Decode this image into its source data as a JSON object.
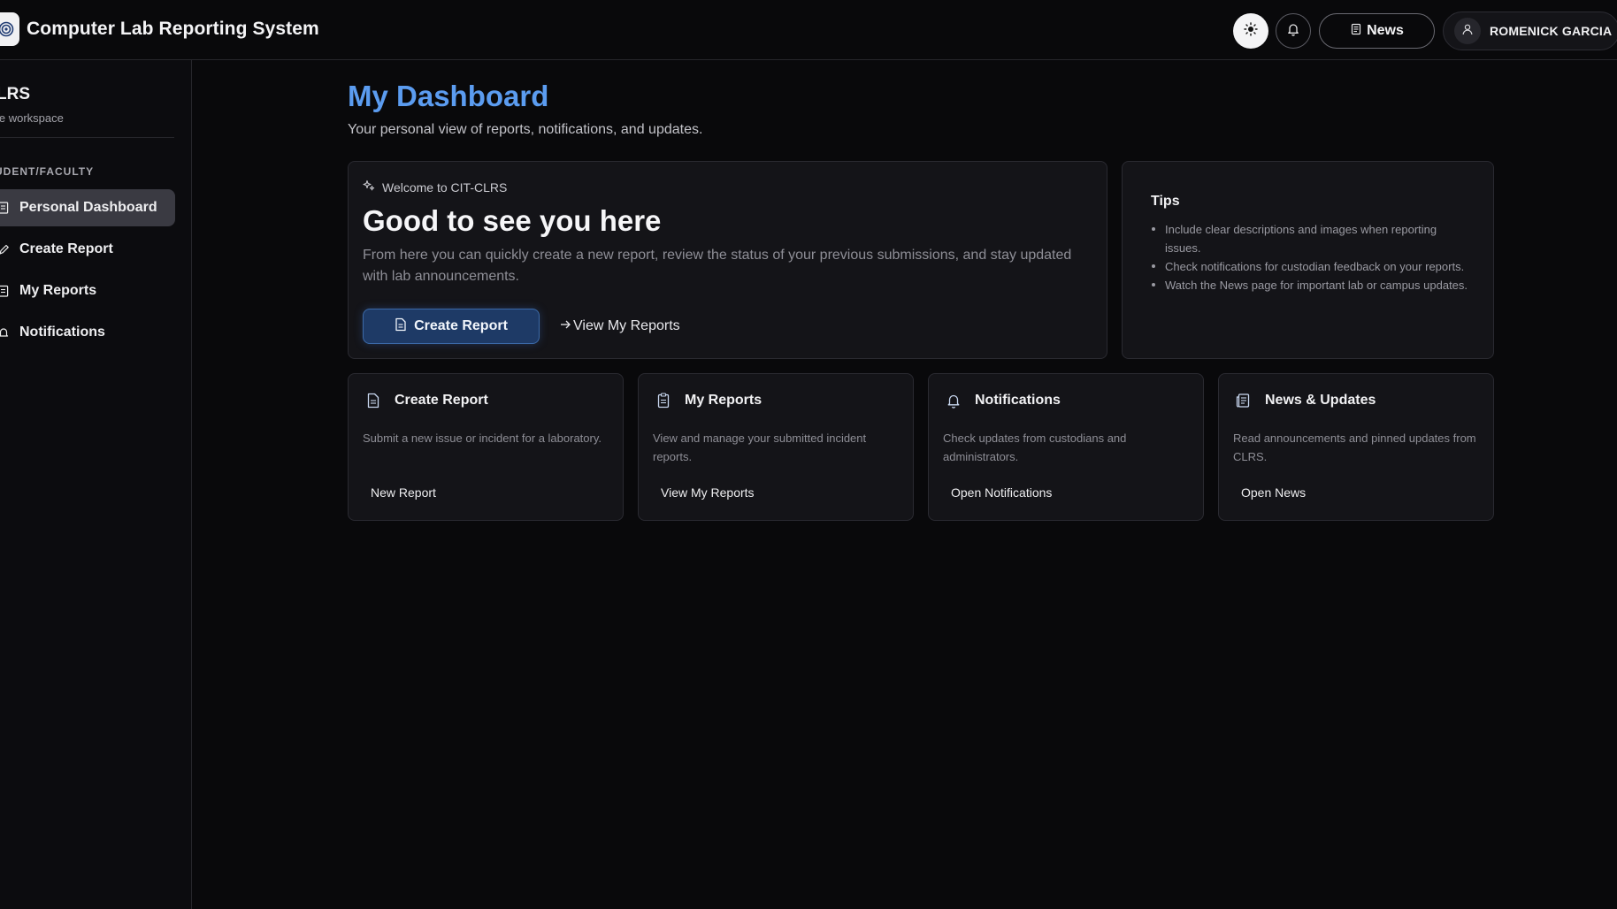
{
  "header": {
    "title": "Computer Lab Reporting System",
    "news_label": "News",
    "user_name": "ROMENICK GARCIA"
  },
  "sidebar": {
    "title": "LRS",
    "subtitle": "le workspace",
    "section": "UDENT/FACULTY",
    "items": [
      {
        "label": "Personal Dashboard",
        "icon": "dashboard-icon",
        "active": true
      },
      {
        "label": "Create Report",
        "icon": "edit-icon",
        "active": false
      },
      {
        "label": "My Reports",
        "icon": "reports-icon",
        "active": false
      },
      {
        "label": "Notifications",
        "icon": "bell-icon",
        "active": false
      }
    ]
  },
  "main": {
    "title": "My Dashboard",
    "subtitle": "Your personal view of reports, notifications, and updates.",
    "welcome": {
      "eyebrow": "Welcome to CIT-CLRS",
      "heading": "Good to see you here",
      "description": "From here you can quickly create a new report, review the status of your previous submissions, and stay updated with lab announcements.",
      "primary_button": "Create Report",
      "secondary_link": "View My Reports"
    },
    "tips": {
      "title": "Tips",
      "items": [
        "Include clear descriptions and images when reporting issues.",
        "Check notifications for custodian feedback on your reports.",
        "Watch the News page for important lab or campus updates."
      ]
    },
    "quick_cards": [
      {
        "title": "Create Report",
        "description": "Submit a new issue or incident for a laboratory.",
        "action": "New Report",
        "icon": "document-icon"
      },
      {
        "title": "My Reports",
        "description": "View and manage your submitted incident reports.",
        "action": "View My Reports",
        "icon": "clipboard-icon"
      },
      {
        "title": "Notifications",
        "description": "Check updates from custodians and administrators.",
        "action": "Open Notifications",
        "icon": "bell-icon"
      },
      {
        "title": "News & Updates",
        "description": "Read announcements and pinned updates from CLRS.",
        "action": "Open News",
        "icon": "newspaper-icon"
      }
    ]
  },
  "colors": {
    "background": "#09090b",
    "accent": "#5b9cf0",
    "primary_button": "#1e3a66"
  }
}
